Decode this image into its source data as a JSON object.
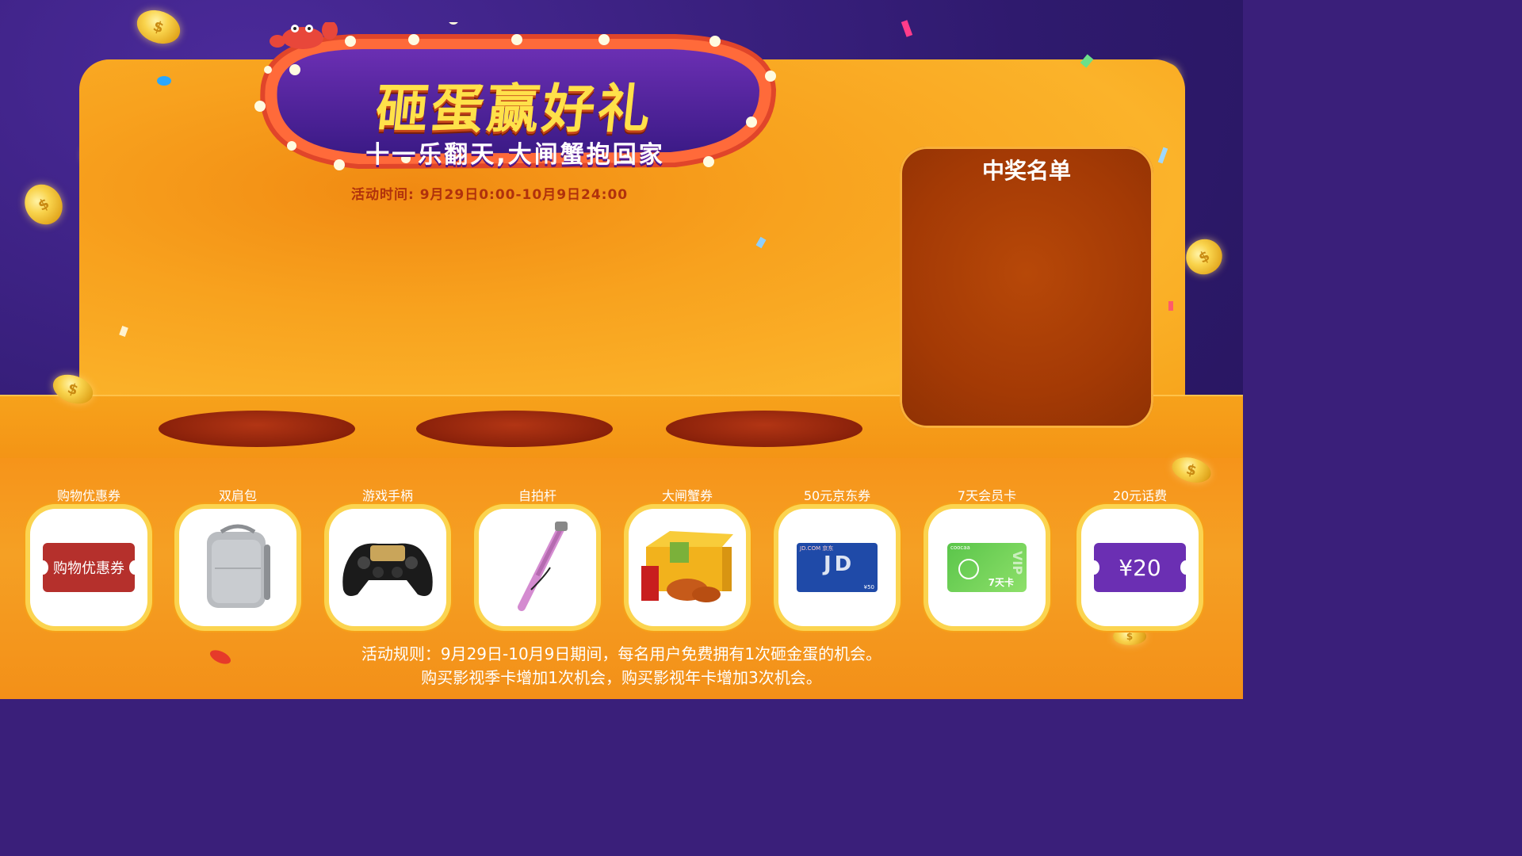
{
  "header": {
    "title": "砸蛋赢好礼",
    "subtitle": "十一乐翻天,大闸蟹抱回家",
    "event_time": "活动时间: 9月29日0:00-10月9日24:00"
  },
  "winners": {
    "title": "中奖名单"
  },
  "prizes": [
    {
      "label": "购物优惠券",
      "ticket_text": "购物优惠券",
      "icon": "coupon-ticket"
    },
    {
      "label": "双肩包",
      "icon": "backpack"
    },
    {
      "label": "游戏手柄",
      "icon": "gamepad"
    },
    {
      "label": "自拍杆",
      "icon": "selfie-stick"
    },
    {
      "label": "大闸蟹券",
      "icon": "crab-gift-box"
    },
    {
      "label": "50元京东券",
      "card_brand": "JD",
      "card_value": "¥50",
      "card_header": "JD.COM 京东",
      "icon": "jd-gift-card"
    },
    {
      "label": "7天会员卡",
      "card_text": "7天卡",
      "card_brand": "coocaa",
      "card_side": "VIP",
      "icon": "vip-card"
    },
    {
      "label": "20元话费",
      "ticket_text": "¥20",
      "icon": "phone-credit-ticket"
    }
  ],
  "rules": {
    "line1": "活动规则：9月29日-10月9日期间，每名用户免费拥有1次砸金蛋的机会。",
    "line2": "购买影视季卡增加1次机会，购买影视年卡增加3次机会。"
  },
  "colors": {
    "background": "#2f1a6e",
    "stage": "#f8a21e",
    "pedestal": "#8a210a",
    "winners_panel": "#a43a05",
    "coupon_red": "#b5302c",
    "phone_ticket_purple": "#6b2fb3",
    "frame_gold": "#fbd450"
  }
}
